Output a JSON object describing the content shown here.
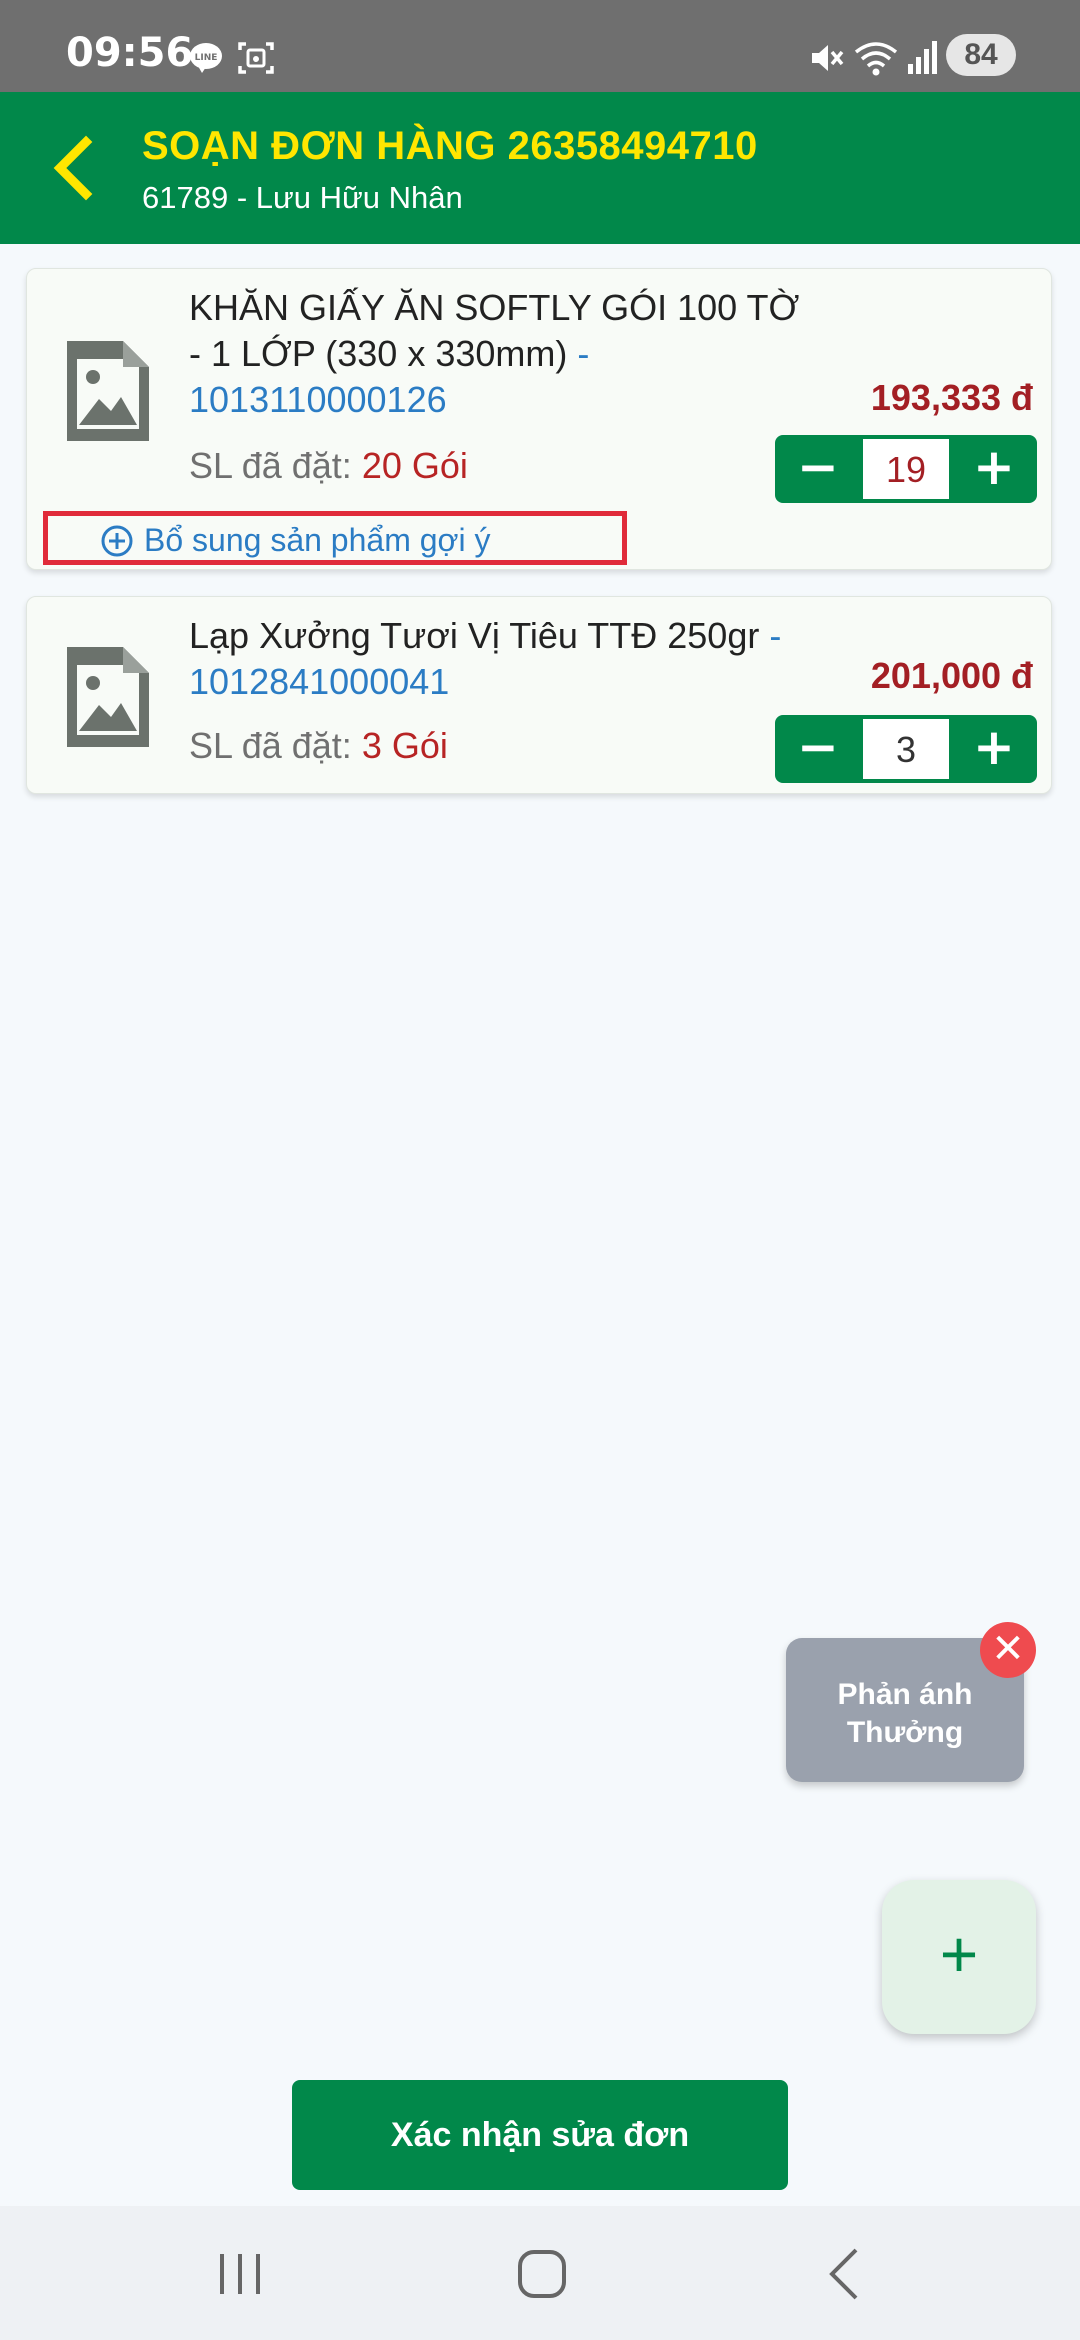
{
  "status_bar": {
    "time": "09:56",
    "battery": "84",
    "icons": [
      "line-icon",
      "screenshot-icon",
      "mute-icon",
      "wifi-icon",
      "signal-icon"
    ]
  },
  "header": {
    "title": "SOẠN ĐƠN HÀNG 26358494710",
    "subtitle": "61789 - Lưu Hữu Nhân",
    "colors": {
      "background": "#01884a",
      "title": "#ffe600"
    }
  },
  "products": [
    {
      "name": "KHĂN GIẤY ĂN SOFTLY GÓI 100 TỜ - 1 LỚP (330 x 330mm)",
      "code_separator": " - ",
      "code": "1013110000126",
      "ordered_label": "SL đã đặt:",
      "ordered_value": "20 Gói",
      "price": "193,333 đ",
      "quantity": "19",
      "suggest_label": "Bổ sung sản phẩm gợi ý"
    },
    {
      "name": "Lạp Xưởng Tươi Vị Tiêu TTĐ 250gr",
      "code_separator": " - ",
      "code": "1012841000041",
      "ordered_label": "SL đã đặt:",
      "ordered_value": "3 Gói",
      "price": "201,000 đ",
      "quantity": "3"
    }
  ],
  "stepper": {
    "minus": "−",
    "plus": "+"
  },
  "feedback": {
    "label": "Phản ánh Thưởng",
    "close": "✕"
  },
  "fab": {
    "label": "+"
  },
  "confirm_button": "Xác nhận sửa đơn",
  "nav_bar": {
    "icons": [
      "recent-apps-icon",
      "home-icon",
      "back-icon"
    ]
  }
}
